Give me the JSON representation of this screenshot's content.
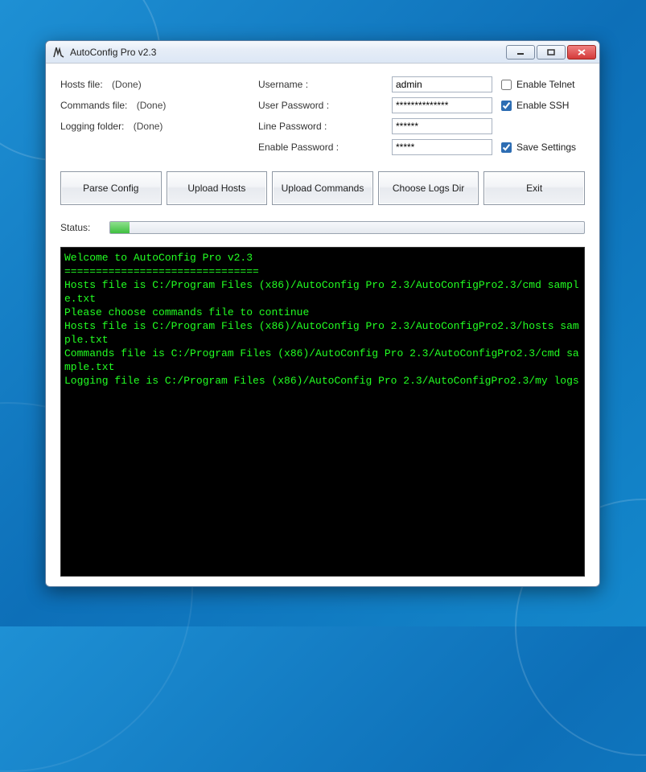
{
  "window": {
    "title": "AutoConfig Pro v2.3"
  },
  "files": {
    "hosts_label": "Hosts file:",
    "hosts_status": "(Done)",
    "commands_label": "Commands file:",
    "commands_status": "(Done)",
    "logging_label": "Logging folder:",
    "logging_status": "(Done)"
  },
  "credentials": {
    "username_label": "Username :",
    "username_value": "admin",
    "user_password_label": "User Password :",
    "user_password_value": "**************",
    "line_password_label": "Line Password :",
    "line_password_value": "******",
    "enable_password_label": "Enable Password :",
    "enable_password_value": "*****"
  },
  "options": {
    "enable_telnet_label": "Enable Telnet",
    "enable_telnet_checked": false,
    "enable_ssh_label": "Enable SSH",
    "enable_ssh_checked": true,
    "save_settings_label": "Save Settings",
    "save_settings_checked": true
  },
  "buttons": {
    "parse": "Parse Config",
    "upload_hosts": "Upload Hosts",
    "upload_commands": "Upload Commands",
    "choose_logs": "Choose Logs Dir",
    "exit": "Exit"
  },
  "status": {
    "label": "Status:",
    "progress_percent": 4
  },
  "console_text": "Welcome to AutoConfig Pro v2.3\n===============================\nHosts file is C:/Program Files (x86)/AutoConfig Pro 2.3/AutoConfigPro2.3/cmd sample.txt\nPlease choose commands file to continue\nHosts file is C:/Program Files (x86)/AutoConfig Pro 2.3/AutoConfigPro2.3/hosts sample.txt\nCommands file is C:/Program Files (x86)/AutoConfig Pro 2.3/AutoConfigPro2.3/cmd sample.txt\nLogging file is C:/Program Files (x86)/AutoConfig Pro 2.3/AutoConfigPro2.3/my logs"
}
